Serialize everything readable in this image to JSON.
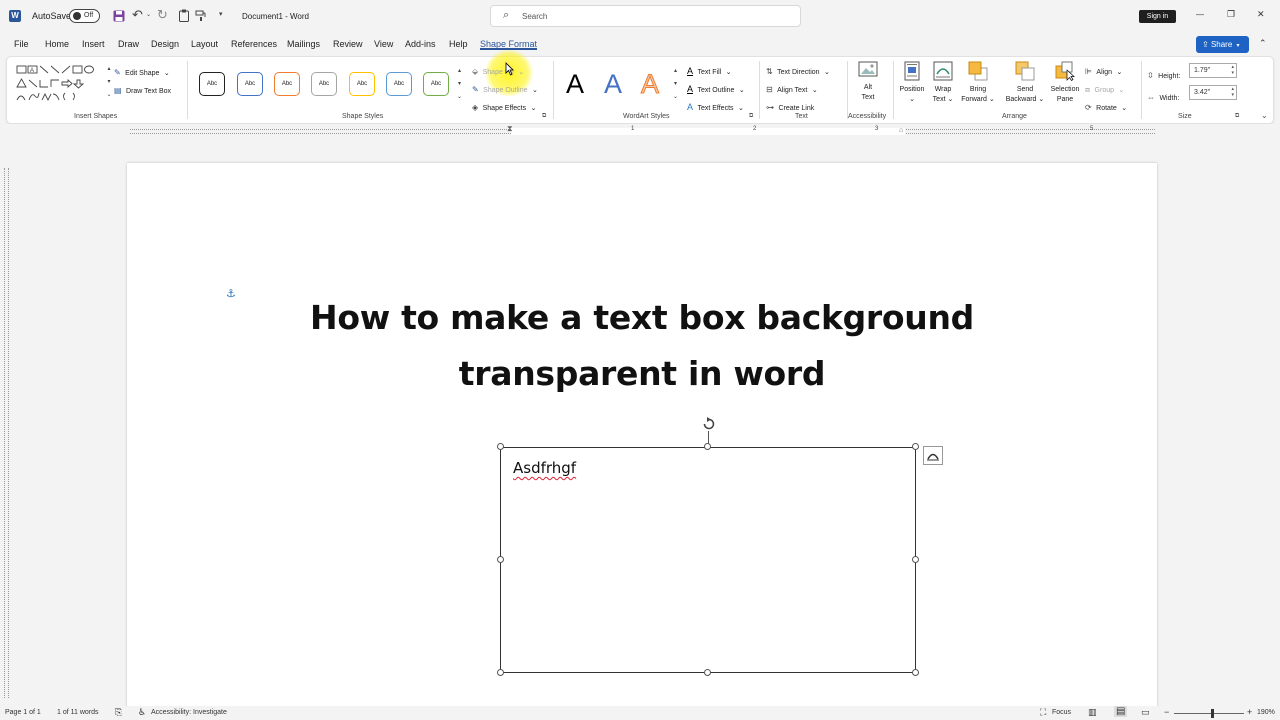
{
  "titlebar": {
    "autosave_label": "AutoSave",
    "autosave_state": "Off",
    "document_title": "Document1 - Word",
    "search_placeholder": "Search",
    "signin_label": "Sign in",
    "minimize_glyph": "—",
    "restore_glyph": "❐",
    "close_glyph": "✕"
  },
  "tabs": [
    "File",
    "Home",
    "Insert",
    "Draw",
    "Design",
    "Layout",
    "References",
    "Mailings",
    "Review",
    "View",
    "Add-ins",
    "Help",
    "Shape Format"
  ],
  "active_tab": "Shape Format",
  "share_label": "Share",
  "ribbon": {
    "insert_shapes": {
      "label": "Insert Shapes",
      "edit_shape": "Edit Shape",
      "draw_text_box": "Draw Text Box"
    },
    "shape_styles": {
      "label": "Shape Styles",
      "style_samples": [
        "Abc",
        "Abc",
        "Abc",
        "Abc",
        "Abc",
        "Abc",
        "Abc"
      ],
      "style_colors": [
        "#222222",
        "#4472c4",
        "#ed7d31",
        "#a5a5a5",
        "#ffc000",
        "#5b9bd5",
        "#70ad47"
      ],
      "shape_fill": "Shape Fill",
      "shape_outline": "Shape Outline",
      "shape_effects": "Shape Effects"
    },
    "wordart_styles": {
      "label": "WordArt Styles",
      "samples": [
        "A",
        "A",
        "A"
      ],
      "text_fill": "Text Fill",
      "text_outline": "Text Outline",
      "text_effects": "Text Effects"
    },
    "text": {
      "label": "Text",
      "text_direction": "Text Direction",
      "align_text": "Align Text",
      "create_link": "Create Link"
    },
    "accessibility": {
      "label": "Accessibility",
      "alt_text_line1": "Alt",
      "alt_text_line2": "Text"
    },
    "arrange": {
      "label": "Arrange",
      "position": "Position",
      "wrap_text_1": "Wrap",
      "wrap_text_2": "Text",
      "bring_forward_1": "Bring",
      "bring_forward_2": "Forward",
      "send_backward_1": "Send",
      "send_backward_2": "Backward",
      "selection_pane_1": "Selection",
      "selection_pane_2": "Pane",
      "align": "Align",
      "group": "Group",
      "rotate": "Rotate"
    },
    "size": {
      "label": "Size",
      "height_label": "Height:",
      "height_value": "1.79\"",
      "width_label": "Width:",
      "width_value": "3.42\""
    }
  },
  "document": {
    "heading_line1": "How to make a text box background",
    "heading_line2": "transparent in word",
    "textbox_text": "Asdfrhgf"
  },
  "statusbar": {
    "page": "Page 1 of 1",
    "words": "1 of 11 words",
    "accessibility": "Accessibility: Investigate",
    "focus": "Focus",
    "zoom": "190%"
  },
  "colors": {
    "accent": "#2b579a",
    "share_bg": "#1e63c4",
    "highlight": "#fff200"
  }
}
